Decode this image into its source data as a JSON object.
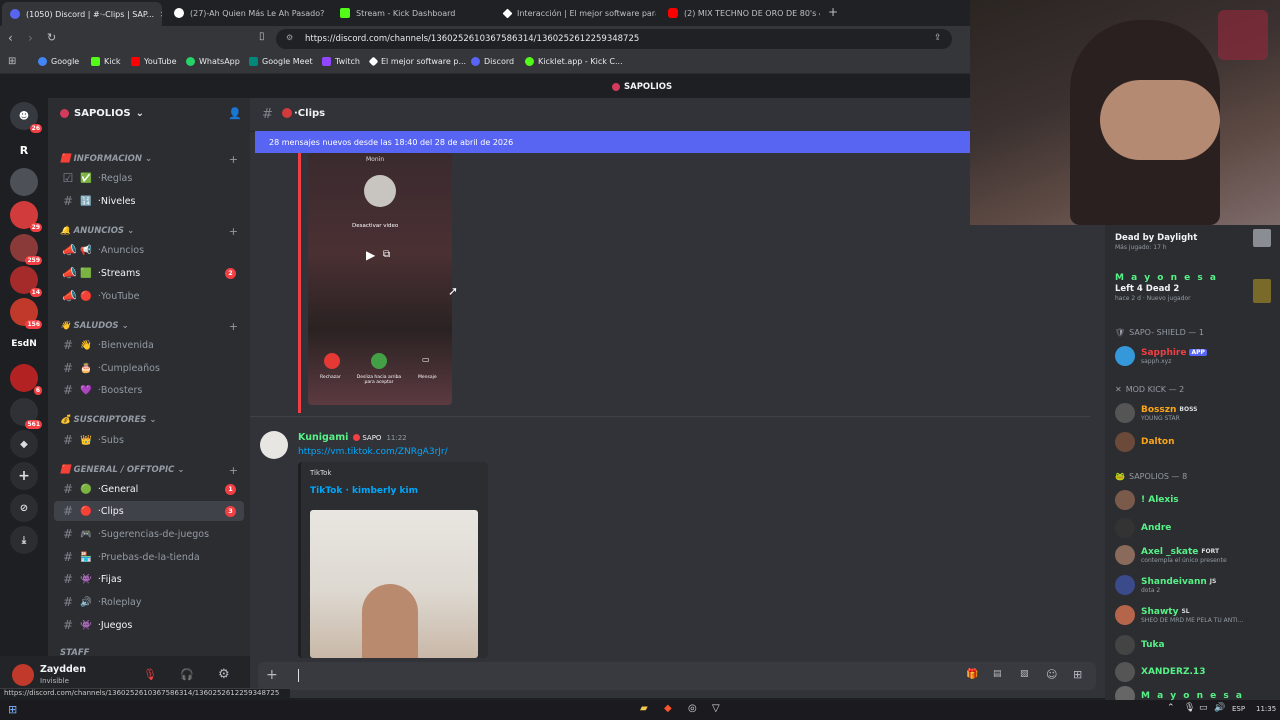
{
  "browser": {
    "tabs": [
      {
        "label": "(1050) Discord | #·-Clips | SAP...",
        "icon": "discord-icon",
        "color": "#5865f2"
      },
      {
        "label": "(27)-Ah Quien Más Le Ah Pasado? xd",
        "icon": "tiktok-icon",
        "color": "#ffffff"
      },
      {
        "label": "Stream - Kick Dashboard",
        "icon": "kick-icon",
        "color": "#53fc18"
      },
      {
        "label": "Interacción | El mejor software para p",
        "icon": "diamond-icon",
        "color": "#ffffff"
      },
      {
        "label": "(2) MIX TECHNO DE ORO DE 80's &",
        "icon": "youtube-icon",
        "color": "#ff0000"
      }
    ],
    "url": "https://discord.com/channels/1360252610367586314/1360252612259348725",
    "bookmarks": [
      {
        "label": "Google",
        "color": "#4285f4"
      },
      {
        "label": "Kick",
        "color": "#53fc18"
      },
      {
        "label": "YouTube",
        "color": "#ff0000"
      },
      {
        "label": "WhatsApp",
        "color": "#25d366"
      },
      {
        "label": "Google Meet",
        "color": "#00897b"
      },
      {
        "label": "Twitch",
        "color": "#9146ff"
      },
      {
        "label": "El mejor software p...",
        "color": "#ffffff"
      },
      {
        "label": "Discord",
        "color": "#5865f2"
      },
      {
        "label": "Kicklet.app - Kick C...",
        "color": "#53fc18"
      }
    ],
    "status_url": "https://discord.com/channels/1360252610367586314/1360252612259348725"
  },
  "discord": {
    "top_title": "SAPOLIOS",
    "server_name": "SAPOLIOS",
    "servers": [
      {
        "label": "",
        "badge": "26",
        "color": "#36393f"
      },
      {
        "label": "R",
        "badge": "",
        "color": "#1e1f22"
      },
      {
        "label": "",
        "badge": "",
        "color": "#4e5058"
      },
      {
        "label": "",
        "badge": "29",
        "color": "#d13b3b"
      },
      {
        "label": "",
        "badge": "259",
        "color": "#8b3a3a"
      },
      {
        "label": "",
        "badge": "14",
        "color": "#a52a2a"
      },
      {
        "label": "",
        "badge": "156",
        "color": "#c0392b"
      },
      {
        "label": "EsdN",
        "badge": "",
        "color": "#1e1f22"
      },
      {
        "label": "",
        "badge": "6",
        "color": "#b22222"
      },
      {
        "label": "",
        "badge": "561",
        "color": "#2f3136"
      }
    ],
    "categories": [
      {
        "label": "INFORMACION",
        "icon": "🟥"
      },
      {
        "label": "ANUNCIOS",
        "icon": "🔔"
      },
      {
        "label": "SALUDOS",
        "icon": "👋"
      },
      {
        "label": "SUSCRIPTORES",
        "icon": "💰"
      },
      {
        "label": "GENERAL / OFFTOPIC",
        "icon": "🟥"
      },
      {
        "label": "STAFF",
        "icon": ""
      }
    ],
    "channels": [
      {
        "label": "·Reglas",
        "icon": "✅",
        "badge": ""
      },
      {
        "label": "·Niveles",
        "icon": "🔢",
        "badge": ""
      },
      {
        "label": "·Anuncios",
        "icon": "📢",
        "badge": ""
      },
      {
        "label": "·Streams",
        "icon": "🟩",
        "badge": "2"
      },
      {
        "label": "·YouTube",
        "icon": "🔴",
        "badge": ""
      },
      {
        "label": "·Bienvenida",
        "icon": "👋",
        "badge": ""
      },
      {
        "label": "·Cumpleaños",
        "icon": "🎂",
        "badge": ""
      },
      {
        "label": "·Boosters",
        "icon": "💜",
        "badge": ""
      },
      {
        "label": "·Subs",
        "icon": "👑",
        "badge": ""
      },
      {
        "label": "·General",
        "icon": "🟢",
        "badge": "1"
      },
      {
        "label": "·Clips",
        "icon": "🔴",
        "badge": "3"
      },
      {
        "label": "·Sugerencias-de-juegos",
        "icon": "🎮",
        "badge": ""
      },
      {
        "label": "·Pruebas-de-la-tienda",
        "icon": "🏪",
        "badge": ""
      },
      {
        "label": "·Fijas",
        "icon": "👾",
        "badge": ""
      },
      {
        "label": "·Roleplay",
        "icon": "🔊",
        "badge": ""
      },
      {
        "label": "·Juegos",
        "icon": "👾",
        "badge": ""
      }
    ],
    "current_channel": "·Clips",
    "new_messages_bar": "28 mensajes nuevos desde las 18:40 del 28 de abril de 2026",
    "video_card": {
      "caller": "Monin",
      "disable_video": "Desactivar video",
      "reject": "Rechazar",
      "slide": "Desliza hacia arriba para aceptar",
      "message": "Mensaje"
    },
    "message": {
      "author": "Kunigami",
      "tag": "SAPO",
      "time": "11:22",
      "link": "https://vm.tiktok.com/ZNRgA3rJr/",
      "embed_provider": "TikTok",
      "embed_title": "TikTok · kimberly kim"
    },
    "user": {
      "name": "Zaydden",
      "status": "Invisible"
    },
    "members": {
      "activity1": {
        "game": "Dead by Daylight",
        "sub": "Más jugado: 17 h"
      },
      "activity2": {
        "name": "M a y o n e s a",
        "game": "Left 4 Dead 2",
        "sub": "hace 2 d · Nuevo jugador"
      },
      "groups": [
        {
          "label": "SAPO- SHIELD — 1"
        },
        {
          "label": "MOD KICK — 2"
        },
        {
          "label": "SAPOLIOS — 8"
        }
      ],
      "list": [
        {
          "name": "Sapphire",
          "tag": "APP",
          "sub": "sapph.xyz",
          "color": "#f23f43"
        },
        {
          "name": "Bosszn",
          "tag": "BOSS",
          "sub": "YOUNG STAR",
          "color": "#faa61a"
        },
        {
          "name": "Dalton",
          "tag": "",
          "sub": "",
          "color": "#faa61a"
        },
        {
          "name": "! Alexis",
          "tag": "",
          "sub": "",
          "color": "#57f287"
        },
        {
          "name": "Andre",
          "tag": "",
          "sub": "",
          "color": "#57f287"
        },
        {
          "name": "Axel _skate",
          "tag": "FORT",
          "sub": "contempla el único presente",
          "color": "#57f287"
        },
        {
          "name": "Shandeivann",
          "tag": "JS",
          "sub": "dota 2",
          "color": "#57f287"
        },
        {
          "name": "Shawty",
          "tag": "SL",
          "sub": "SHEO DE MRD ME PELA TU ANTI...",
          "color": "#57f287"
        },
        {
          "name": "Tuka",
          "tag": "",
          "sub": "",
          "color": "#57f287"
        },
        {
          "name": "XANDERZ.13",
          "tag": "",
          "sub": "",
          "color": "#57f287"
        },
        {
          "name": "M a y o n e s a",
          "tag": "",
          "sub": "",
          "color": "#57f287"
        }
      ]
    }
  },
  "taskbar": {
    "lang": "ESP",
    "time": "11:35"
  }
}
